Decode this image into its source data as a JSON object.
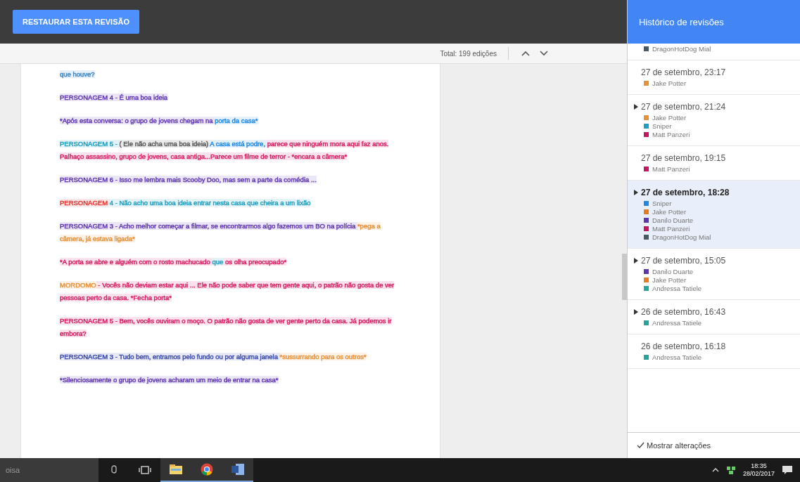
{
  "topbar": {
    "restore_button": "RESTAURAR ESTA REVISÃO"
  },
  "toolbar": {
    "total": "Total: 199 edições"
  },
  "document": {
    "paragraphs": [
      {
        "segments": [
          {
            "text": "que houve?",
            "color": "#3d85c6"
          }
        ]
      },
      {
        "segments": [
          {
            "text": "PERSONAGEM 4 - É uma boa ideia",
            "color": "#5e35b1"
          }
        ]
      },
      {
        "segments": [
          {
            "text": "*Após esta conversa: o grupo de jovens chegam na ",
            "color": "#5e35b1"
          },
          {
            "text": "porta da casa*",
            "color": "#1e88e5"
          }
        ]
      },
      {
        "segments": [
          {
            "text": "PERSONAGEM 5 - ",
            "color": "#1e9fc0"
          },
          {
            "text": "( Ele não acha uma boa ideia) ",
            "color": "#555555"
          },
          {
            "text": "A casa está podre, ",
            "color": "#1e88e5"
          },
          {
            "text": "parece que ninguém mora aqui faz anos. Palhaço assassino, grupo de jovens, casa antiga...Parece um filme de terror - *encara a câmera*",
            "color": "#d81b60"
          }
        ]
      },
      {
        "segments": [
          {
            "text": "PERSONAGEM 6 - Isso me lembra mais Scooby Doo, mas sem a parte da comédia ...",
            "color": "#5e35b1"
          }
        ]
      },
      {
        "segments": [
          {
            "text": "PERSONAGEM",
            "color": "#e53935"
          },
          {
            "text": " 4 - Não acho uma boa ideia entrar nesta casa que cheira a um lixão",
            "color": "#1e9fc0"
          }
        ]
      },
      {
        "segments": [
          {
            "text": "PERSONAGEM 3 - Acho melhor começar a filmar, se encontrarmos algo fazemos um BO na polícia ",
            "color": "#5e35b1"
          },
          {
            "text": "*pega a câmera, já estava ligada*",
            "color": "#e69138"
          }
        ]
      },
      {
        "segments": [
          {
            "text": "*A porta se abre e alguém com o rosto machucado ",
            "color": "#d81b60"
          },
          {
            "text": "que",
            "color": "#1e9fc0"
          },
          {
            "text": " os olha preocupado*",
            "color": "#d81b60"
          }
        ]
      },
      {
        "segments": [
          {
            "text": "MORDOMO",
            "color": "#e69138"
          },
          {
            "text": " - Vocês não deviam estar aqui ... Ele não pode saber que tem gente aqui, o patrão não gosta de ver pessoas perto da casa. *Fecha porta*",
            "color": "#d81b60"
          }
        ]
      },
      {
        "segments": [
          {
            "text": "PERSONAGEM 5 - Bem, vocês ouviram o moço. O patrão não gosta de ver gente perto da casa. Já podemos ir embora?",
            "color": "#d81b60"
          }
        ]
      },
      {
        "segments": [
          {
            "text": "PERSONAGEM 3 - Tudo bem, entramos pelo fundo ou por alguma janela ",
            "color": "#3949ab"
          },
          {
            "text": "*sussurrando para os outros*",
            "color": "#e69138"
          }
        ]
      },
      {
        "segments": [
          {
            "text": "*Silenciosamente o grupo de jovens acharam um meio de entrar na casa*",
            "color": "#5e35b1"
          }
        ]
      }
    ]
  },
  "panel": {
    "title": "Histórico de revisões",
    "revisions": [
      {
        "selected": false,
        "authors": [
          {
            "name": "DragonHotDog Mial",
            "color": "#455a64"
          }
        ]
      },
      {
        "date": "27 de setembro, 23:17",
        "expandable": false,
        "selected": false,
        "authors": [
          {
            "name": "Jake Potter",
            "color": "#e69138"
          }
        ]
      },
      {
        "date": "27 de setembro, 21:24",
        "expandable": true,
        "selected": false,
        "authors": [
          {
            "name": "Jake Potter",
            "color": "#e69138"
          },
          {
            "name": "Sniper",
            "color": "#1e9fc0"
          },
          {
            "name": "Matt Panzeri",
            "color": "#c2185b"
          }
        ]
      },
      {
        "date": "27 de setembro, 19:15",
        "expandable": false,
        "selected": false,
        "authors": [
          {
            "name": "Matt Panzeri",
            "color": "#c2185b"
          }
        ]
      },
      {
        "date": "27 de setembro, 18:28",
        "expandable": true,
        "selected": true,
        "authors": [
          {
            "name": "Sniper",
            "color": "#1e88e5"
          },
          {
            "name": "Jake Potter",
            "color": "#e67c22"
          },
          {
            "name": "Danilo Duarte",
            "color": "#5e35b1"
          },
          {
            "name": "Matt Panzeri",
            "color": "#c2185b"
          },
          {
            "name": "DragonHotDog Mial",
            "color": "#455a64"
          }
        ]
      },
      {
        "date": "27 de setembro, 15:05",
        "expandable": true,
        "selected": false,
        "authors": [
          {
            "name": "Danilo Duarte",
            "color": "#5e35b1"
          },
          {
            "name": "Jake Potter",
            "color": "#e67c22"
          },
          {
            "name": "Andressa Tatiele",
            "color": "#26a69a"
          }
        ]
      },
      {
        "date": "26 de setembro, 16:43",
        "expandable": true,
        "selected": false,
        "authors": [
          {
            "name": "Andressa Tatiele",
            "color": "#26a69a"
          }
        ]
      },
      {
        "date": "26 de setembro, 16:18",
        "expandable": false,
        "selected": false,
        "authors": [
          {
            "name": "Andressa Tatiele",
            "color": "#26a69a"
          }
        ]
      }
    ],
    "show_changes": {
      "label": "Mostrar alterações",
      "checked": true
    }
  },
  "taskbar": {
    "search_text": "oisa",
    "time": "18:35",
    "date": "28/02/2017"
  }
}
